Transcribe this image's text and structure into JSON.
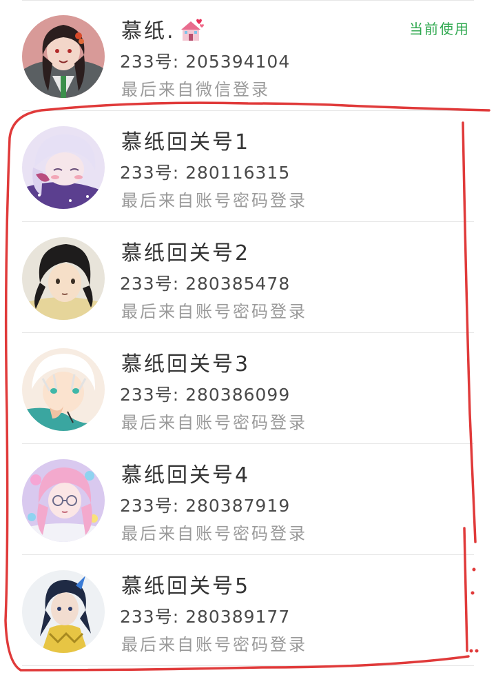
{
  "accounts": [
    {
      "name": "慕纸.",
      "account_no": "233号: 205394104",
      "source": "最后来自微信登录",
      "status": "当前使用",
      "avatar": "anime-girl-dark-hair-red-flowers",
      "emoji": "wedding-chapel-with-hearts"
    },
    {
      "name": "慕纸回关号1",
      "account_no": "233号: 280116315",
      "source": "最后来自账号密码登录",
      "avatar": "anime-girl-white-hair-purple"
    },
    {
      "name": "慕纸回关号2",
      "account_no": "233号: 280385478",
      "source": "最后来自账号密码登录",
      "avatar": "anime-boy-black-hair"
    },
    {
      "name": "慕纸回关号3",
      "account_no": "233号: 280386099",
      "source": "最后来自账号密码登录",
      "avatar": "anime-boy-white-hair-teal-eyes"
    },
    {
      "name": "慕纸回关号4",
      "account_no": "233号: 280387919",
      "source": "最后来自账号密码登录",
      "avatar": "anime-girl-pink-hair-glasses"
    },
    {
      "name": "慕纸回关号5",
      "account_no": "233号: 280389177",
      "source": "最后来自账号密码登录",
      "avatar": "anime-character-blue-black-hair-yellow-coat"
    }
  ],
  "colors": {
    "status_green": "#2fa84f",
    "annotation_red": "#e03a3a",
    "name_text": "#333333",
    "source_text": "#9a9a9a"
  }
}
